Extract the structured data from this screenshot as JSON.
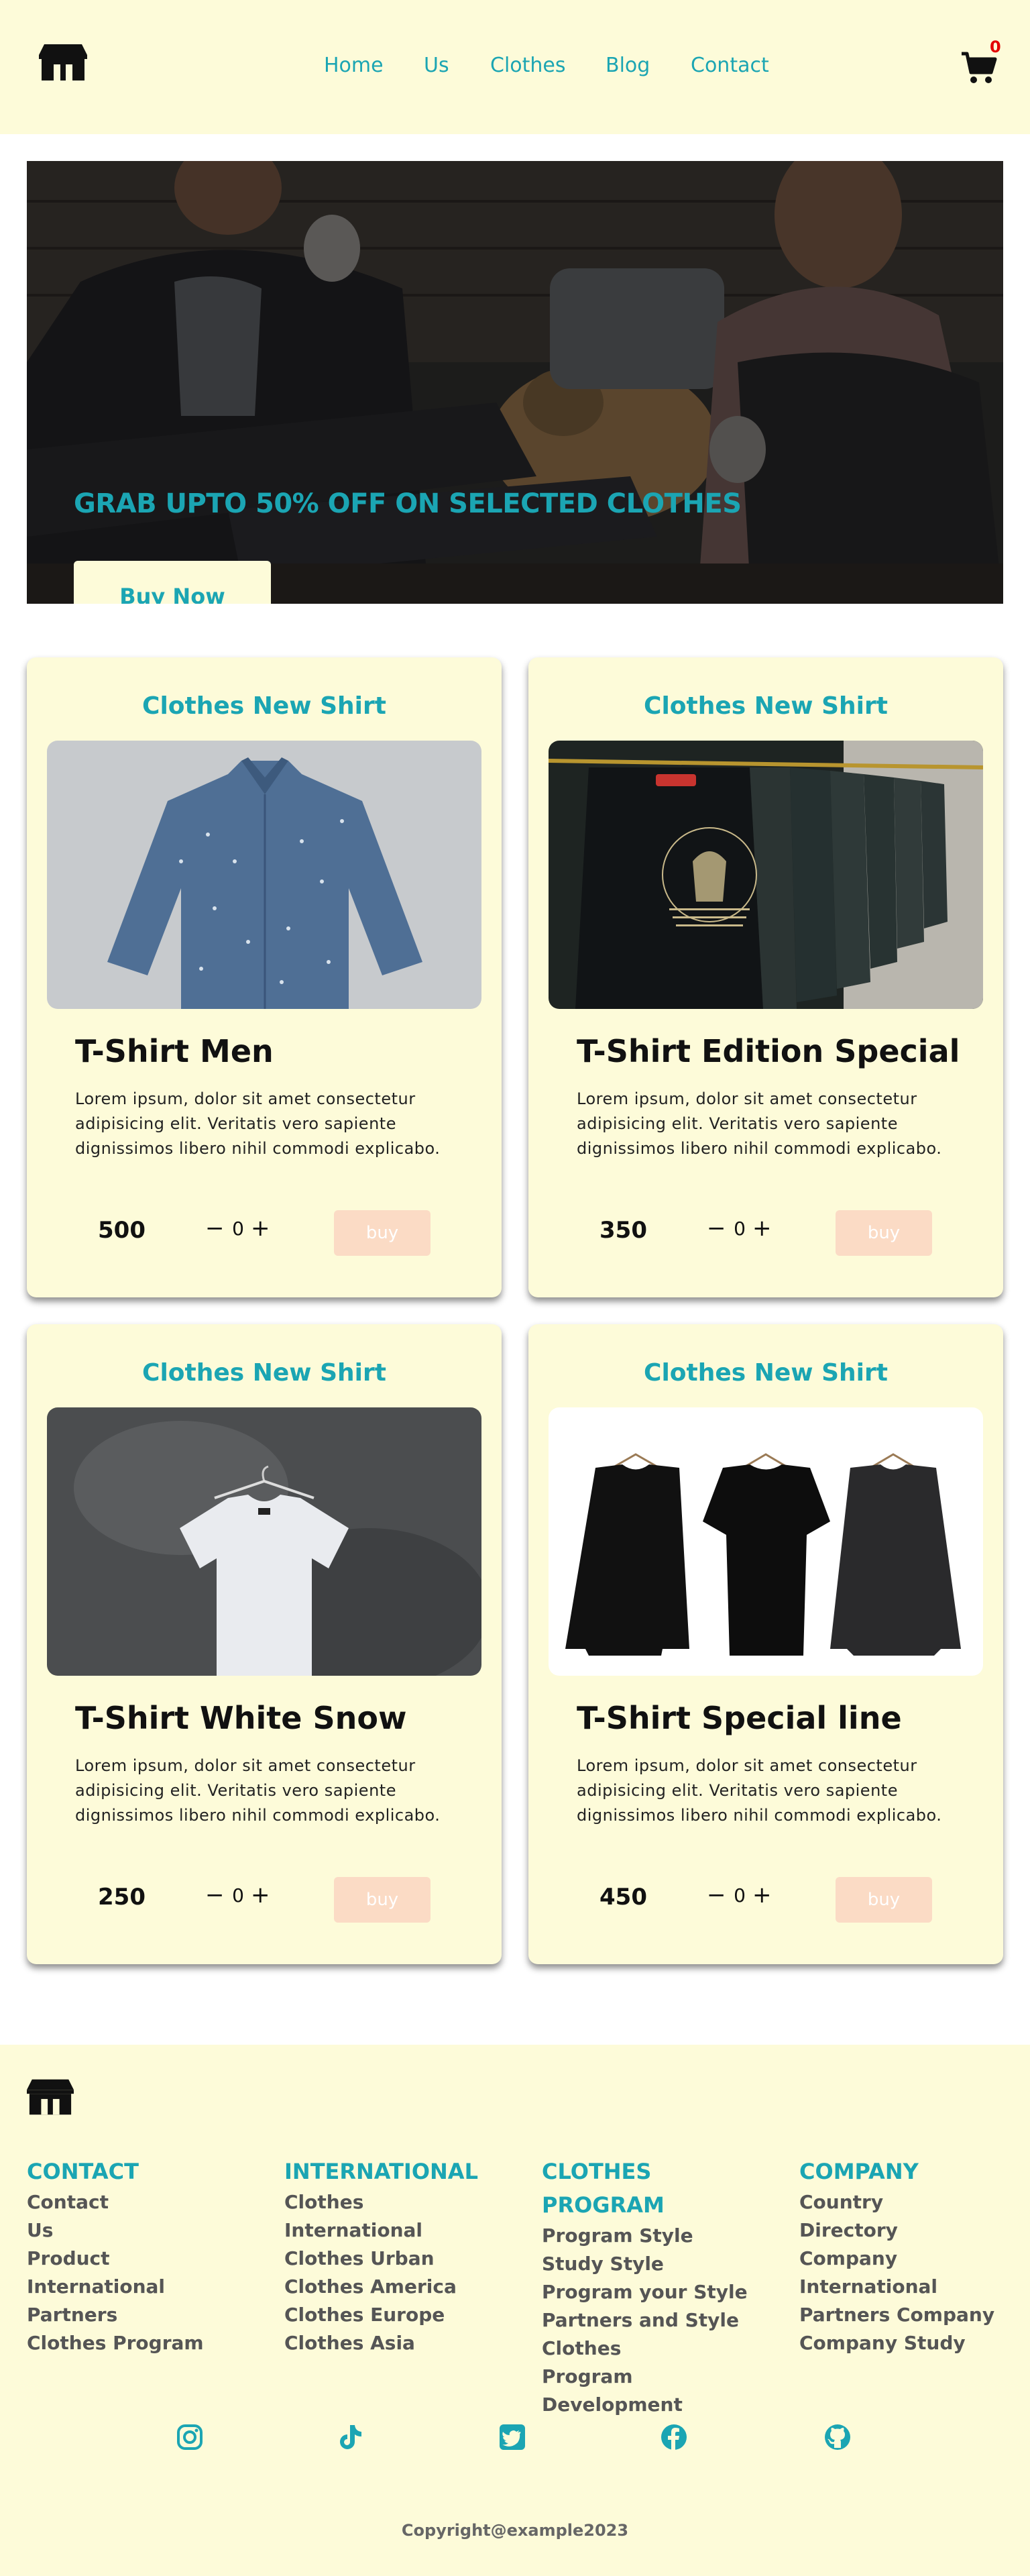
{
  "header": {
    "nav": [
      "Home",
      "Us",
      "Clothes",
      "Blog",
      "Contact"
    ],
    "cart_count": "0"
  },
  "hero": {
    "title": "GRAB UPTO 50% OFF ON SELECTED CLOTHES",
    "button": "Buy Now"
  },
  "products": [
    {
      "heading": "Clothes New Shirt",
      "title": "T-Shirt Men",
      "description": "Lorem ipsum, dolor sit amet consectetur adipisicing elit. Veritatis vero sapiente dignissimos libero nihil commodi explicabo.",
      "price": "500",
      "qty": "0",
      "buy": "buy",
      "image": "blue-denim-shirt"
    },
    {
      "heading": "Clothes New Shirt",
      "title": "T-Shirt Edition Special",
      "description": "Lorem ipsum, dolor sit amet consectetur adipisicing elit. Veritatis vero sapiente dignissimos libero nihil commodi explicabo.",
      "price": "350",
      "qty": "0",
      "buy": "buy",
      "image": "black-tshirts-on-rack"
    },
    {
      "heading": "Clothes New Shirt",
      "title": "T-Shirt White Snow",
      "description": "Lorem ipsum, dolor sit amet consectetur adipisicing elit. Veritatis vero sapiente dignissimos libero nihil commodi explicabo.",
      "price": "250",
      "qty": "0",
      "buy": "buy",
      "image": "white-tshirt-on-hanger"
    },
    {
      "heading": "Clothes New Shirt",
      "title": "T-Shirt Special line",
      "description": "Lorem ipsum, dolor sit amet consectetur adipisicing elit. Veritatis vero sapiente dignissimos libero nihil commodi explicabo.",
      "price": "450",
      "qty": "0",
      "buy": "buy",
      "image": "three-black-shirts"
    }
  ],
  "footer": {
    "columns": [
      {
        "title": "CONTACT",
        "links": [
          "Contact",
          "Us",
          "Product",
          "International",
          "Partners",
          "Clothes Program"
        ]
      },
      {
        "title": "INTERNATIONAL",
        "links": [
          "Clothes",
          "International",
          "Clothes Urban",
          "Clothes America",
          "Clothes Europe",
          "Clothes Asia"
        ]
      },
      {
        "title": "CLOTHES PROGRAM",
        "links": [
          "Program Style",
          "Study Style",
          "Program your Style",
          "Partners and Style",
          "Clothes Program Development"
        ]
      },
      {
        "title": "COMPANY",
        "links": [
          "Country",
          "Directory",
          "Company",
          "International",
          "Partners Company",
          "Company Study"
        ]
      }
    ],
    "social": [
      "instagram-icon",
      "tiktok-icon",
      "twitter-icon",
      "facebook-icon",
      "github-icon"
    ],
    "copyright": "Copyright@example2023"
  },
  "colors": {
    "accent": "#1ba5b3",
    "cream": "#fdfbd9",
    "buy_button": "#fbdbc5",
    "badge": "#e30000"
  }
}
